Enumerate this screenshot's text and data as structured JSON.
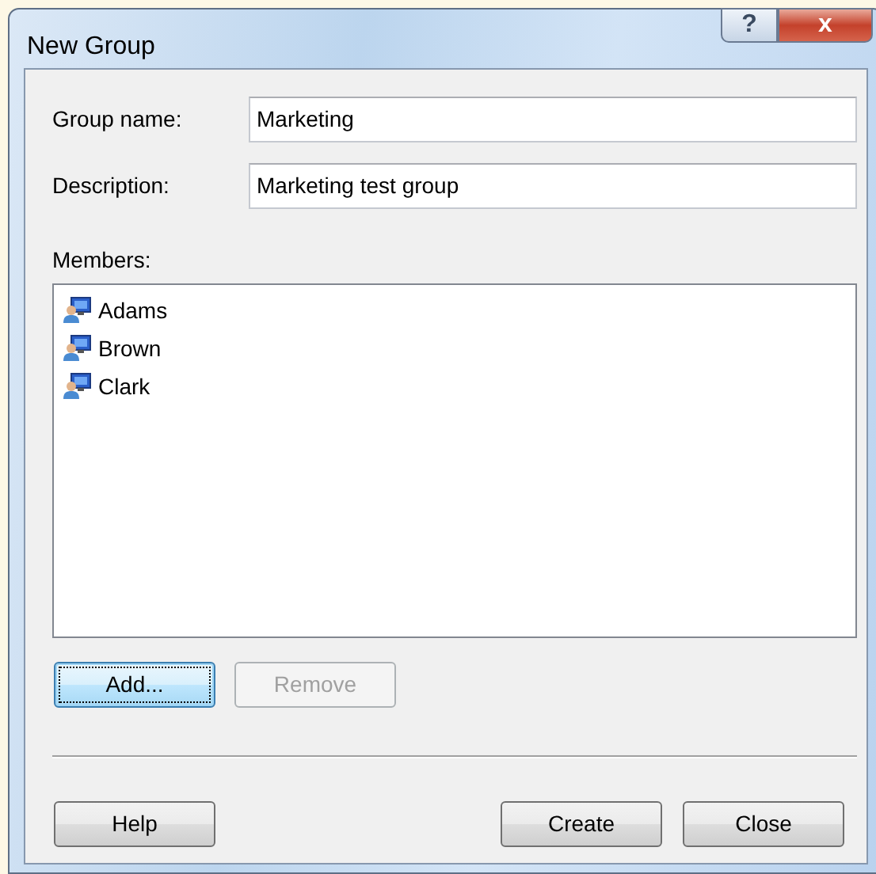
{
  "window": {
    "title": "New Group"
  },
  "title_buttons": [
    {
      "kind": "help",
      "label": "?"
    },
    {
      "kind": "close",
      "label": "x"
    }
  ],
  "fields": [
    {
      "label": "Group name:",
      "value": "Marketing"
    },
    {
      "label": "Description:",
      "value": "Marketing test group"
    }
  ],
  "members": {
    "label": "Members:",
    "items": [
      {
        "name": "Adams"
      },
      {
        "name": "Brown"
      },
      {
        "name": "Clark"
      }
    ]
  },
  "member_buttons": [
    {
      "label": "Add...",
      "focused": true,
      "disabled": false
    },
    {
      "label": "Remove",
      "focused": false,
      "disabled": true
    }
  ],
  "footer_left_buttons": [
    {
      "label": "Help"
    }
  ],
  "footer_right_buttons": [
    {
      "label": "Create"
    },
    {
      "label": "Close"
    }
  ]
}
